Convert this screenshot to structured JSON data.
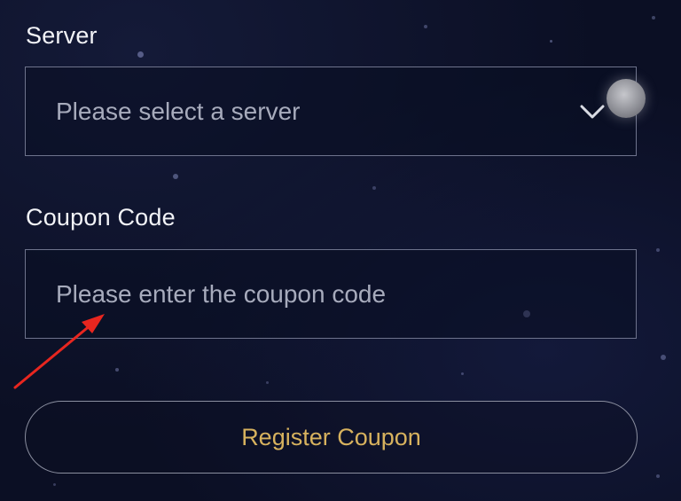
{
  "server": {
    "label": "Server",
    "placeholder": "Please select a server",
    "icon": "chevron-down-icon"
  },
  "coupon": {
    "label": "Coupon Code",
    "placeholder": "Please enter the coupon code"
  },
  "submit": {
    "label": "Register Coupon"
  },
  "colors": {
    "background": "#0b0f24",
    "accent_text": "#d7b25e",
    "annotation_arrow": "#e8261f",
    "field_border": "#6e738c"
  }
}
